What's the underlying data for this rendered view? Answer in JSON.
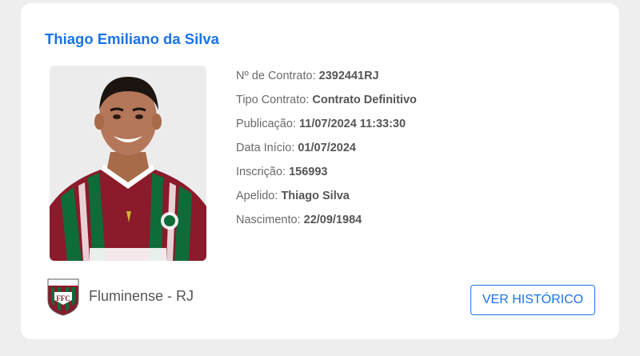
{
  "player": {
    "name": "Thiago Emiliano da Silva",
    "photo_alt": "Thiago Silva"
  },
  "contract": {
    "rows": [
      {
        "label": "Nº de Contrato:",
        "value": "2392441RJ"
      },
      {
        "label": "Tipo Contrato:",
        "value": "Contrato Definitivo"
      },
      {
        "label": "Publicação:",
        "value": "11/07/2024 11:33:30"
      },
      {
        "label": "Data Início:",
        "value": "01/07/2024"
      },
      {
        "label": "Inscrição:",
        "value": "156993"
      },
      {
        "label": "Apelido:",
        "value": "Thiago Silva"
      },
      {
        "label": "Nascimento:",
        "value": "22/09/1984"
      }
    ]
  },
  "club": {
    "name": "Fluminense - RJ",
    "crest_icon": "fluminense-crest-icon"
  },
  "actions": {
    "history_label": "VER HISTÓRICO"
  },
  "colors": {
    "accent": "#1a73e8",
    "jersey_red": "#8b1a2b",
    "jersey_green": "#0f6b3a"
  }
}
